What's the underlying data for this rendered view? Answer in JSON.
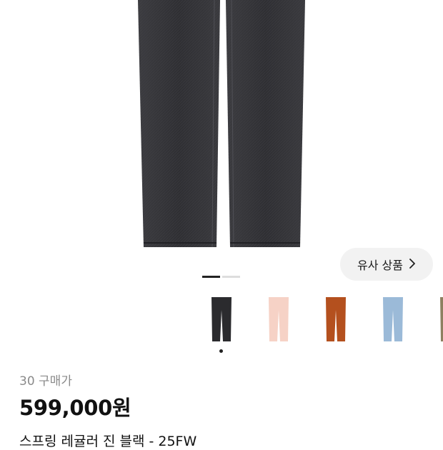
{
  "similar_button": {
    "label": "유사 상품",
    "icon": "chevron-right-icon"
  },
  "pager": {
    "total": 2,
    "active": 1
  },
  "thumbnails": [
    {
      "color_name": "black",
      "color": "#2b2b2e",
      "selected": true
    },
    {
      "color_name": "pink",
      "color": "#f6d2c6",
      "selected": false
    },
    {
      "color_name": "rust",
      "color": "#b4501e",
      "selected": false
    },
    {
      "color_name": "light-blue",
      "color": "#9bbad8",
      "selected": false
    },
    {
      "color_name": "camo",
      "color": "#8d8060",
      "selected": false
    }
  ],
  "product": {
    "sold_count": "30 구매가",
    "price": "599,000원",
    "title": "스프링 레귤러 진 블랙 - 25FW"
  },
  "colors": {
    "jeans_main": "#3a3a3e",
    "pager_active": "#222222"
  }
}
